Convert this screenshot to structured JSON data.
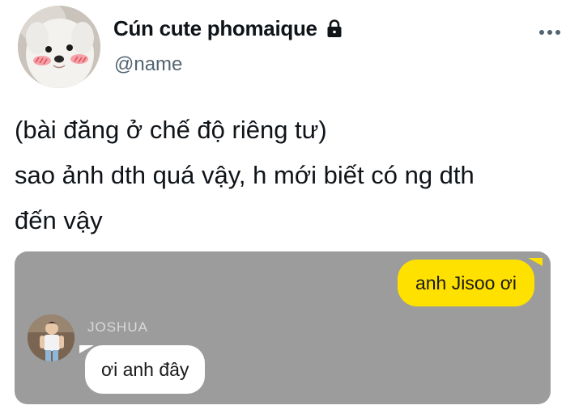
{
  "author": {
    "display_name": "Cún cute phomaique",
    "handle": "@name",
    "protected_icon": "lock-icon",
    "avatar": "white-puppy-avatar"
  },
  "actions": {
    "more_icon": "more-horizontal-icon"
  },
  "tweet": {
    "lines": [
      "(bài đăng ở chế độ riêng tư)",
      "sao ảnh dth quá vậy, h mới biết có ng dth",
      "đến vậy"
    ]
  },
  "media": {
    "background": "#9c9c9c",
    "chat": {
      "outgoing_message": "anh Jisoo ơi",
      "outgoing_color": "#ffe100",
      "sender_name": "JOSHUA",
      "incoming_message": "ơi anh đây",
      "incoming_color": "#ffffff"
    }
  }
}
